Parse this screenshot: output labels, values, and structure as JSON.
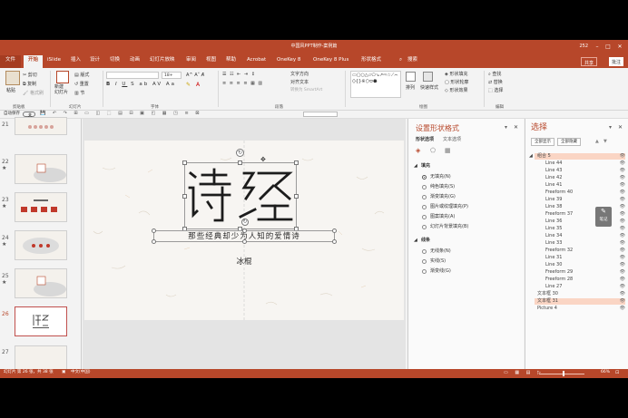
{
  "window": {
    "title": "中国风PPT制作-案例篇",
    "user": "252",
    "autosave": "自动保存",
    "autosave_state": "关"
  },
  "tabs": [
    "文件",
    "开始",
    "iSlide",
    "插入",
    "设计",
    "切换",
    "动画",
    "幻灯片放映",
    "审阅",
    "视图",
    "帮助",
    "Acrobat",
    "OneKey 8",
    "OneKey 8 Plus",
    "形状格式"
  ],
  "active_tab": "开始",
  "search_label": "搜索",
  "share_label": "共享",
  "comment_label": "批注",
  "ribbon": {
    "clipboard": {
      "label": "剪贴板",
      "paste": "粘贴",
      "cut": "剪切",
      "copy": "复制",
      "format_painter": "格式刷"
    },
    "slides": {
      "label": "幻灯片",
      "new_slide": "新建\n幻灯片",
      "layout": "版式",
      "reset": "重置",
      "section": "节"
    },
    "font": {
      "label": "字体",
      "size": "18+"
    },
    "paragraph": {
      "label": "段落",
      "text_direction": "文字方向",
      "align_text": "对齐文本",
      "smartart": "转换为 SmartArt"
    },
    "drawing": {
      "label": "绘图",
      "arrange": "排列",
      "quick_styles": "快速样式",
      "fill": "形状填充",
      "outline": "形状轮廓",
      "effects": "形状效果"
    },
    "editing": {
      "label": "编辑",
      "find": "查找",
      "replace": "替换",
      "select": "选择"
    }
  },
  "thumbnails": [
    {
      "num": "21",
      "star": ""
    },
    {
      "num": "22",
      "star": "★"
    },
    {
      "num": "23",
      "star": "★"
    },
    {
      "num": "24",
      "star": "★"
    },
    {
      "num": "25",
      "star": "★"
    },
    {
      "num": "26",
      "star": "",
      "active": true
    },
    {
      "num": "27",
      "star": ""
    }
  ],
  "slide": {
    "title_glyphs": "诗经",
    "subtitle": "那些经典却少为人知的爱情诗",
    "author": "冰棍"
  },
  "format_pane": {
    "title": "设置形状格式",
    "tab_shape": "形状选项",
    "tab_text": "文本选项",
    "fill_header": "填充",
    "fill_options": [
      "无填充(N)",
      "纯色填充(S)",
      "渐变填充(G)",
      "图片或纹理填充(P)",
      "图案填充(A)",
      "幻灯片背景填充(B)"
    ],
    "fill_selected": 0,
    "line_header": "线条",
    "line_options": [
      "无线条(N)",
      "实线(S)",
      "渐变线(G)"
    ]
  },
  "selection_pane": {
    "title": "选择",
    "show_all": "全部显示",
    "hide_all": "全部隐藏",
    "items": [
      {
        "name": "组合 5",
        "level": 0,
        "hl": true
      },
      {
        "name": "Line 44",
        "level": 1
      },
      {
        "name": "Line 43",
        "level": 1
      },
      {
        "name": "Line 42",
        "level": 1
      },
      {
        "name": "Line 41",
        "level": 1
      },
      {
        "name": "Freeform 40",
        "level": 1
      },
      {
        "name": "Line 39",
        "level": 1
      },
      {
        "name": "Line 38",
        "level": 1
      },
      {
        "name": "Freeform 37",
        "level": 1
      },
      {
        "name": "Line 36",
        "level": 1
      },
      {
        "name": "Line 35",
        "level": 1
      },
      {
        "name": "Line 34",
        "level": 1
      },
      {
        "name": "Line 33",
        "level": 1
      },
      {
        "name": "Freeform 32",
        "level": 1
      },
      {
        "name": "Line 31",
        "level": 1
      },
      {
        "name": "Line 30",
        "level": 1
      },
      {
        "name": "Freeform 29",
        "level": 1
      },
      {
        "name": "Freeform 28",
        "level": 1
      },
      {
        "name": "Line 27",
        "level": 1
      },
      {
        "name": "文本框 30",
        "level": 0
      },
      {
        "name": "文本框 31",
        "level": 0,
        "hl": true
      },
      {
        "name": "Picture 4",
        "level": 0
      }
    ]
  },
  "note_button": "笔记",
  "status": {
    "slide_info": "幻灯片 第 26 张，共 38 张",
    "language": "中文(中国)",
    "zoom": "66%"
  },
  "colors": {
    "accent": "#b7472a",
    "title_glyph": "#1c1c1c",
    "subtitle": "#2b2b2b",
    "highlight": "#fad5c4"
  }
}
